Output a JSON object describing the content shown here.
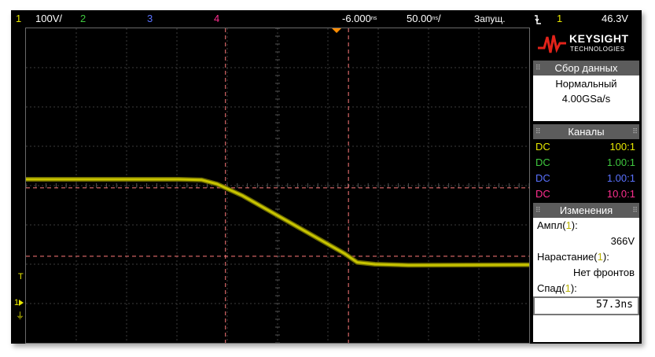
{
  "topbar": {
    "ch1_num": "1",
    "ch1_scale": "100V/",
    "ch2_num": "2",
    "ch3_num": "3",
    "ch4_num": "4",
    "time_delay": "-6.000",
    "time_delay_unit": "ns",
    "time_scale": "50.00",
    "time_scale_unit": "ns",
    "run_state": "Запущ.",
    "trigger_icon": "trigger-falling-edge-icon",
    "trigger_channel": "1",
    "trigger_level": "46.3V"
  },
  "colors": {
    "ch1": "#e8e800",
    "ch2": "#3fc83f",
    "ch3": "#5a72ff",
    "ch4": "#ff2f8f",
    "trace": "#c8c400",
    "cursor": "#ff7a7a",
    "marker": "#ff8c00"
  },
  "screen": {
    "trigger_marker": "T",
    "ground_marker": "1"
  },
  "brand": {
    "name": "KEYSIGHT",
    "sub": "TECHNOLOGIES"
  },
  "acquisition": {
    "header": "Сбор данных",
    "mode": "Нормальный",
    "rate": "4.00GSa/s"
  },
  "channels": {
    "header": "Каналы",
    "rows": [
      {
        "coupling": "DC",
        "ratio": "100:1"
      },
      {
        "coupling": "DC",
        "ratio": "1.00:1"
      },
      {
        "coupling": "DC",
        "ratio": "1.00:1"
      },
      {
        "coupling": "DC",
        "ratio": "10.0:1"
      }
    ]
  },
  "measurements": {
    "header": "Изменения",
    "items": [
      {
        "label_pre": "Ампл(",
        "ch": "1",
        "label_post": "):",
        "value": "366V"
      },
      {
        "label_pre": "Нарастание(",
        "ch": "1",
        "label_post": "):",
        "value": "Нет фронтов"
      },
      {
        "label_pre": "Спад(",
        "ch": "1",
        "label_post": "):",
        "value": "57.3ns"
      }
    ]
  },
  "chart_data": {
    "type": "line",
    "title": "",
    "xlabel": "",
    "ylabel": "",
    "x": [
      -250,
      -130,
      -112,
      -100,
      -80,
      -60,
      -40,
      -20,
      0,
      10,
      24,
      50,
      145
    ],
    "series": [
      {
        "values": [
          320,
          320,
          318,
          305,
          268,
          222,
          176,
          130,
          84,
          56,
          50,
          47,
          48
        ]
      }
    ],
    "xlim": [
      -250,
      145
    ],
    "x_units": "ns",
    "ylim": [
      -200,
      800
    ],
    "y_units": "V",
    "grid": true
  }
}
